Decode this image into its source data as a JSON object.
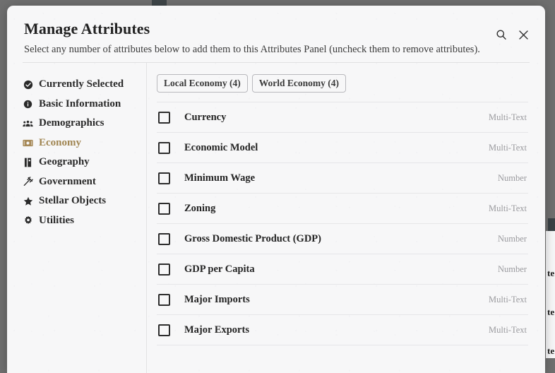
{
  "modal": {
    "title": "Manage Attributes",
    "subtitle": "Select any number of attributes below to add them to this Attributes Panel (uncheck them to remove attributes).",
    "search_icon": "search-icon",
    "close_icon": "close-icon",
    "accent_color": "#a08551",
    "background_color": "#f7f7f8",
    "overlay_color": "#6f6f6f"
  },
  "sidebar": {
    "items": [
      {
        "label": "Currently Selected",
        "icon": "check-circle-icon",
        "active": false
      },
      {
        "label": "Basic Information",
        "icon": "info-circle-icon",
        "active": false
      },
      {
        "label": "Demographics",
        "icon": "people-icon",
        "active": false
      },
      {
        "label": "Economy",
        "icon": "money-bill-icon",
        "active": true
      },
      {
        "label": "Geography",
        "icon": "map-icon",
        "active": false
      },
      {
        "label": "Government",
        "icon": "gavel-icon",
        "active": false
      },
      {
        "label": "Stellar Objects",
        "icon": "star-icon",
        "active": false
      },
      {
        "label": "Utilities",
        "icon": "gear-icon",
        "active": false
      }
    ]
  },
  "content": {
    "tabs": [
      {
        "label": "Local Economy (4)"
      },
      {
        "label": "World Economy (4)"
      }
    ],
    "attributes": [
      {
        "label": "Currency",
        "type": "Multi-Text",
        "checked": false
      },
      {
        "label": "Economic Model",
        "type": "Multi-Text",
        "checked": false
      },
      {
        "label": "Minimum Wage",
        "type": "Number",
        "checked": false
      },
      {
        "label": "Zoning",
        "type": "Multi-Text",
        "checked": false
      },
      {
        "label": "Gross Domestic Product (GDP)",
        "type": "Number",
        "checked": false
      },
      {
        "label": "GDP per Capita",
        "type": "Number",
        "checked": false
      },
      {
        "label": "Major Imports",
        "type": "Multi-Text",
        "checked": false
      },
      {
        "label": "Major Exports",
        "type": "Multi-Text",
        "checked": false
      }
    ]
  },
  "background": {
    "text_fragments": [
      "te",
      "te",
      "te"
    ]
  }
}
